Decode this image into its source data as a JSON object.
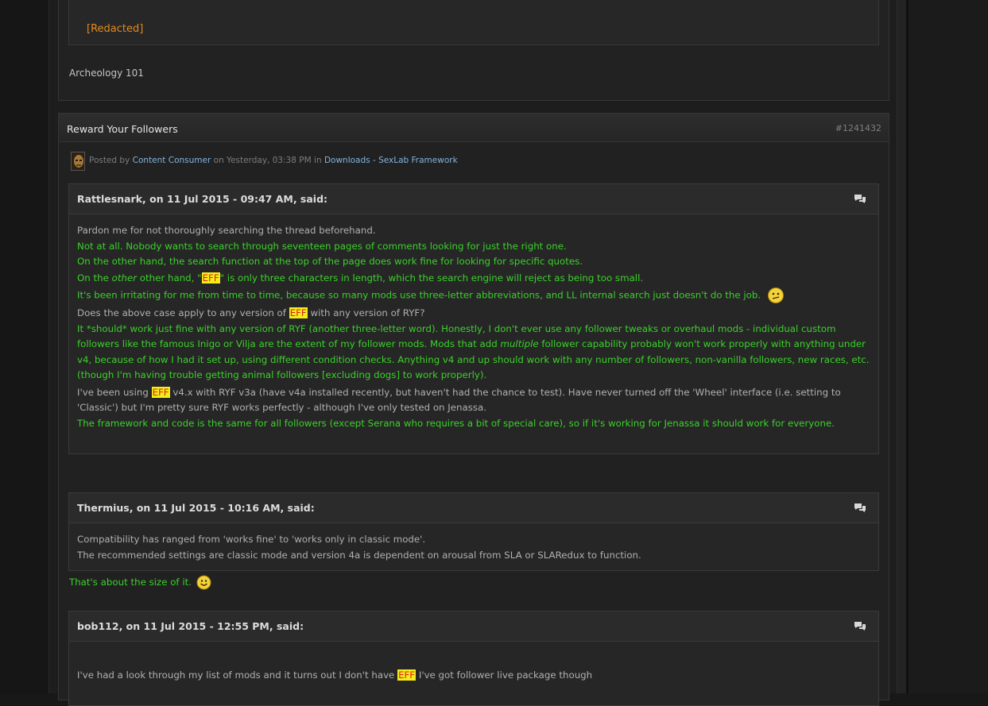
{
  "prev_post": {
    "redacted": "[Redacted]",
    "signature": "Archeology 101"
  },
  "post": {
    "title": "Reward Your Followers",
    "id": "#1241432",
    "meta": {
      "posted_by": "Posted by",
      "author": "Content Consumer",
      "on": "on Yesterday, 03:38 PM in",
      "category": "Downloads - SexLab Framework"
    },
    "quote1": {
      "cite": "Rattlesnark, on 11 Jul 2015 - 09:47 AM, said:",
      "l1": "Pardon me for not thoroughly searching the thread beforehand.",
      "l2": "Not at all. Nobody wants to search through seventeen pages of comments looking for just the right one.",
      "l3": "On the other hand, the search function at the top of the page does work fine for looking for specific quotes.",
      "l4a": "On the ",
      "l4b": "other",
      "l4c": " other hand, \"",
      "l4d": "EFF",
      "l4e": "\" is only three characters in length, which the search engine will reject as being too small.",
      "l5": "It's been irritating for me from time to time, because so many mods use three-letter abbreviations, and LL internal search just doesn't do the job.",
      "l6a": "Does the above case apply to any version of ",
      "l6b": "EFF",
      "l6c": " with any version of RYF?",
      "p7a": "It *should* work just fine with any version of RYF (another three-letter word). Honestly, I don't ever use any follower tweaks or overhaul mods - individual custom followers like the famous Inigo or Vilja are the extent of my follower mods. Mods that add ",
      "p7b": "multiple",
      "p7c": " follower capability probably won't work properly with anything under v4, because of how I had it set up, using different condition checks. Anything v4 and up should work with any number of followers, non-vanilla followers, new races, etc. (though I'm having trouble getting animal followers [excluding dogs] to work properly).",
      "p8a": "I've been using ",
      "p8b": "EFF",
      "p8c": " v4.x with RYF v3a (have v4a installed recently, but haven't had the chance to test). Have never turned off the 'Wheel' interface (i.e. setting to 'Classic') but I'm pretty sure RYF works perfectly - although I've only tested on Jenassa.",
      "l9": "The framework and code is the same for all followers (except Serana who requires a bit of special care), so if it's working for Jenassa it should work for everyone."
    },
    "quote2": {
      "cite": "Thermius, on 11 Jul 2015 - 10:16 AM, said:",
      "l1": "Compatibility has ranged from 'works fine' to 'works only in classic mode'.",
      "l2": "The recommended settings are classic mode and version 4a is dependent on arousal from SLA or SLARedux to function."
    },
    "reply2": "That's about the size of it.",
    "quote3": {
      "cite": "bob112, on 11 Jul 2015 - 12:55 PM, said:",
      "l1a": "I've had a look through my list of mods and it turns out I don't have ",
      "l1b": "EFF",
      "l1c": " I've got follower live package though"
    }
  },
  "colors": {
    "reply_green": "#3bd12a",
    "link_blue": "#82b4de",
    "redacted_orange": "#e38a1c",
    "highlight_bg": "#f4ee18",
    "highlight_text": "#e21f1f"
  },
  "icons": [
    "quote-bubbles-icon",
    "confused-smiley-icon",
    "smile-smiley-icon"
  ]
}
